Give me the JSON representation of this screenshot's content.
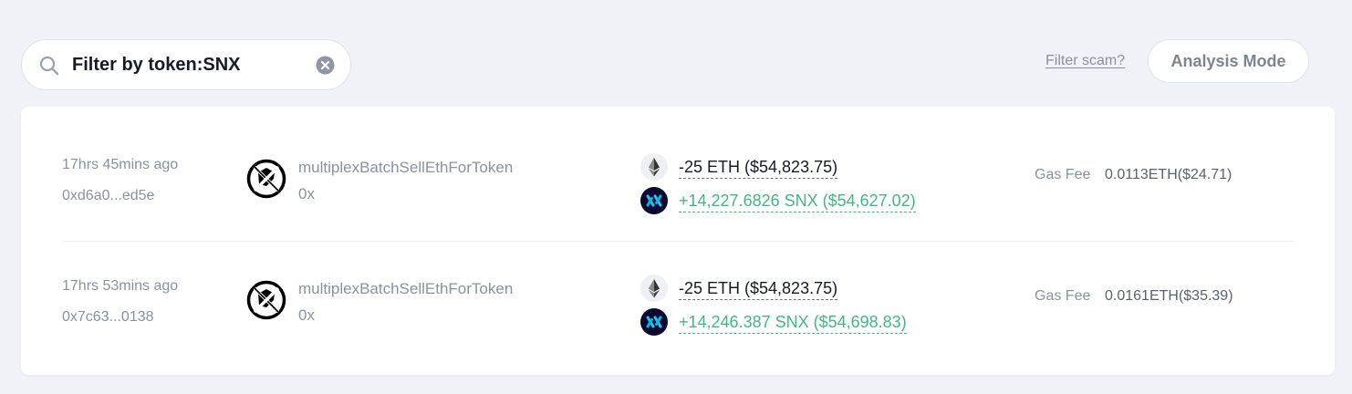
{
  "search": {
    "value": "Filter by token:SNX",
    "placeholder": "Filter by token"
  },
  "header": {
    "filter_scam_label": "Filter scam?",
    "analysis_mode_label": "Analysis Mode"
  },
  "colors": {
    "background": "#f0f2f7",
    "card": "#ffffff",
    "incoming": "#3fba7f",
    "muted_text": "#8a91a1",
    "snx_icon_bg": "#0b0830"
  },
  "transactions": [
    {
      "time": "17hrs 45mins ago",
      "hash": "0xd6a0...ed5e",
      "protocol_icon": "0x-protocol-icon",
      "method": "multiplexBatchSellEthForToken",
      "protocol": "0x",
      "sent": {
        "icon": "eth-icon",
        "amount": "-25 ETH ($54,823.75)"
      },
      "received": {
        "icon": "snx-icon",
        "amount": "+14,227.6826 SNX ($54,627.02)"
      },
      "gas_label": "Gas Fee",
      "gas_value": "0.0113ETH($24.71)"
    },
    {
      "time": "17hrs 53mins ago",
      "hash": "0x7c63...0138",
      "protocol_icon": "0x-protocol-icon",
      "method": "multiplexBatchSellEthForToken",
      "protocol": "0x",
      "sent": {
        "icon": "eth-icon",
        "amount": "-25 ETH ($54,823.75)"
      },
      "received": {
        "icon": "snx-icon",
        "amount": "+14,246.387 SNX ($54,698.83)"
      },
      "gas_label": "Gas Fee",
      "gas_value": "0.0161ETH($35.39)"
    }
  ]
}
